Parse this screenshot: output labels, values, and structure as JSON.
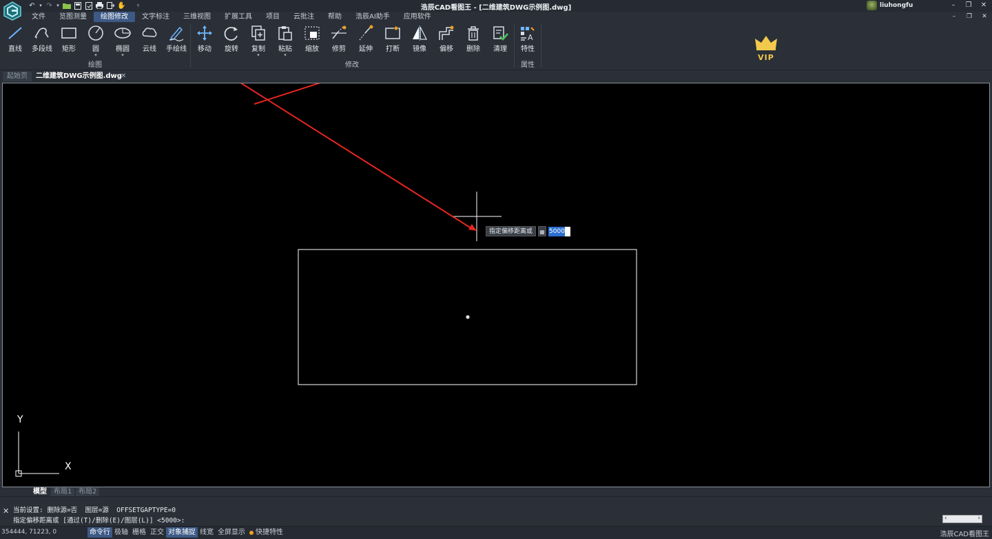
{
  "window": {
    "title": "浩辰CAD看图王 - [二维建筑DWG示例图.dwg]",
    "user_name": "liuhongfu"
  },
  "menu": [
    "文件",
    "览图测量",
    "绘图修改",
    "文字标注",
    "三维视图",
    "扩展工具",
    "项目",
    "云批注",
    "帮助",
    "浩辰AI助手",
    "应用软件"
  ],
  "menu_active_index": 2,
  "ribbon": {
    "draw_group": {
      "label": "绘图",
      "tools": [
        "直线",
        "多段线",
        "矩形",
        "圆",
        "椭圆",
        "云线",
        "手绘线"
      ]
    },
    "modify_group": {
      "label": "修改",
      "tools": [
        "移动",
        "旋转",
        "复制",
        "粘贴",
        "缩放",
        "修剪",
        "延伸",
        "打断",
        "镜像",
        "偏移",
        "删除",
        "清理"
      ]
    },
    "property_group": {
      "label": "属性",
      "tools": [
        "特性"
      ]
    },
    "vip_label": "VIP"
  },
  "doc_tabs": {
    "start": "起始页",
    "file": "二维建筑DWG示例图.dwg"
  },
  "canvas": {
    "prompt_label": "指定偏移距离或",
    "prompt_value": "5000",
    "ucs_x": "X",
    "ucs_y": "Y"
  },
  "layout_tabs": [
    "模型",
    "布局1",
    "布局2"
  ],
  "command": {
    "line1": "当前设置: 删除源=否  图层=源  OFFSETGAPTYPE=0",
    "line2": "指定偏移距离或 [通过(T)/删除(E)/图层(L)] <5000>:"
  },
  "status": {
    "coords": "354444, 71223, 0",
    "toggles": [
      {
        "label": "命令行",
        "on": true
      },
      {
        "label": "极轴",
        "on": false
      },
      {
        "label": "栅格",
        "on": false
      },
      {
        "label": "正交",
        "on": false
      },
      {
        "label": "对象捕捉",
        "on": true
      },
      {
        "label": "线宽",
        "on": false
      },
      {
        "label": "全屏显示",
        "on": false
      }
    ],
    "quick_prop": "快捷特性",
    "app_name": "浩辰CAD看图王"
  },
  "colors": {
    "accent": "#3d5a86",
    "annotation_arrow": "#e8261f",
    "vip_gold": "#f2c94c"
  }
}
